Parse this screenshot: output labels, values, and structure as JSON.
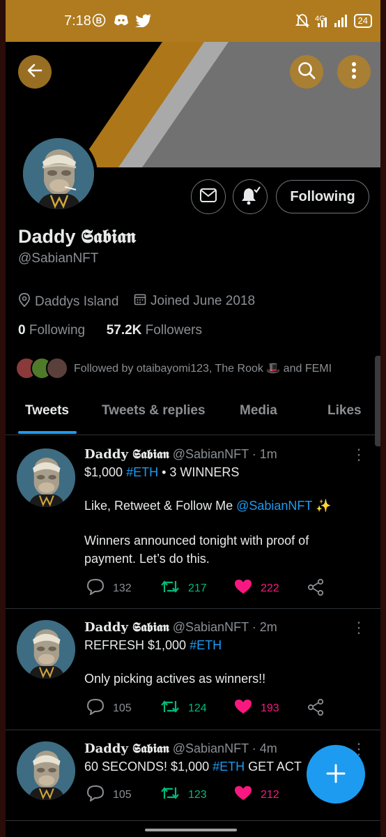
{
  "status_bar": {
    "time": "7:18",
    "icons": [
      "b-circle-icon",
      "discord-icon",
      "twitter-bird-icon",
      "mute-icon",
      "signal-4g-icon",
      "signal-bars-icon"
    ],
    "net_label": "4G",
    "battery": "24"
  },
  "header": {
    "back_icon": "arrow-left-icon",
    "search_icon": "search-icon",
    "more_icon": "more-vertical-icon"
  },
  "profile": {
    "name": "Daddy 𝕾𝖆𝖇𝖎𝖆𝖓",
    "handle": "@SabianNFT",
    "location": "Daddys Island",
    "joined": "Joined June 2018",
    "following_count": "0",
    "following_label": "Following",
    "followers_count": "57.2K",
    "followers_label": "Followers",
    "followed_by": "Followed by otaibayomi123, The Rook 🎩 and FEMI",
    "follow_button": "Following"
  },
  "tabs": [
    {
      "label": "Tweets",
      "active": true
    },
    {
      "label": "Tweets & replies",
      "active": false
    },
    {
      "label": "Media",
      "active": false
    },
    {
      "label": "Likes",
      "active": false
    }
  ],
  "tweets": [
    {
      "name": "Daddy 𝕾𝖆𝖇𝖎𝖆𝖓",
      "handle": "@SabianNFT",
      "time": "· 1m",
      "line1_pre": "$1,000 ",
      "line1_tag": "#ETH",
      "line1_post": " • 3 WINNERS",
      "line2_pre": "Like, Retweet & Follow Me ",
      "line2_mention": "@SabianNFT",
      "line2_post": " ✨",
      "line3": "Winners announced tonight with proof of",
      "line4": "payment. Let’s do this.",
      "replies": "132",
      "retweets": "217",
      "likes": "222"
    },
    {
      "name": "Daddy 𝕾𝖆𝖇𝖎𝖆𝖓",
      "handle": "@SabianNFT",
      "time": "· 2m",
      "line1_pre": "REFRESH $1,000 ",
      "line1_tag": "#ETH",
      "line2": "Only picking actives as winners!!",
      "replies": "105",
      "retweets": "124",
      "likes": "193"
    },
    {
      "name": "Daddy 𝕾𝖆𝖇𝖎𝖆𝖓",
      "handle": "@SabianNFT",
      "time": "· 4m",
      "line1_pre": "60 SECONDS! $1,000 ",
      "line1_tag": "#ETH",
      "line1_post": " GET ACT",
      "replies": "105",
      "retweets": "123",
      "likes": "212"
    }
  ],
  "colors": {
    "accent": "#1d9bf0",
    "retweet": "#00ba7c",
    "like": "#f91880",
    "status_bar": "#b07b1e",
    "banner_orange": "#d4911f",
    "banner_gray": "#8a8a8a"
  },
  "fab_icon": "plus-icon"
}
